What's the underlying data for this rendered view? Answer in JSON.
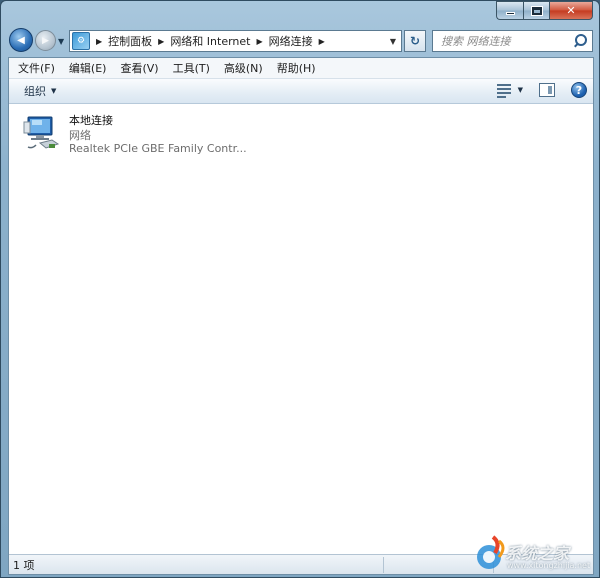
{
  "caption": {
    "minimize_label": "",
    "maximize_label": "",
    "close_label": "✕"
  },
  "navigation": {
    "back_glyph": "◀",
    "forward_glyph": "▶",
    "breadcrumbs": [
      "控制面板",
      "网络和 Internet",
      "网络连接"
    ],
    "refresh_glyph": "↻"
  },
  "search": {
    "placeholder": "搜索 网络连接"
  },
  "menubar": {
    "items": [
      "文件(F)",
      "编辑(E)",
      "查看(V)",
      "工具(T)",
      "高级(N)",
      "帮助(H)"
    ]
  },
  "toolbar": {
    "organize_label": "组织",
    "help_glyph": "?"
  },
  "connections": [
    {
      "name": "本地连接",
      "status": "网络",
      "device": "Realtek PCIe GBE Family Contr..."
    }
  ],
  "statusbar": {
    "item_count": "1 项"
  },
  "watermark": {
    "text": "系统之家",
    "sub": "www.xitongzhijia.net"
  },
  "colors": {
    "frame": "#8cb1cc",
    "accent": "#1c5fae",
    "close": "#c43a1f"
  }
}
